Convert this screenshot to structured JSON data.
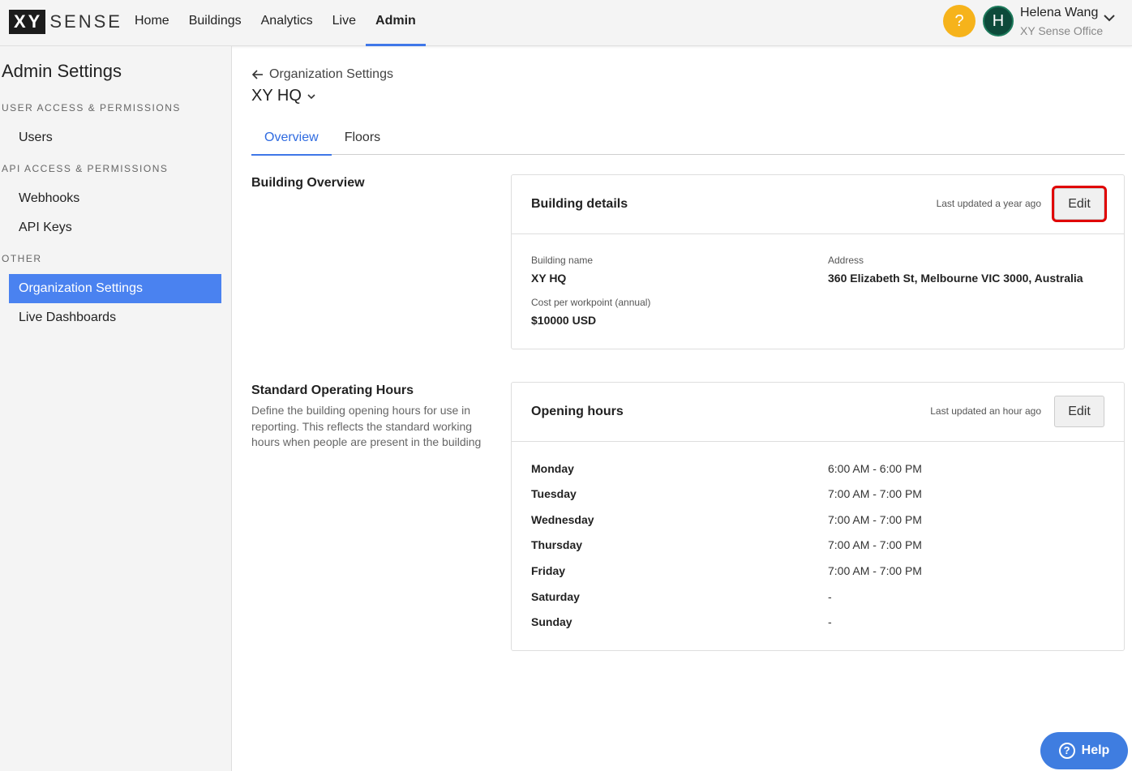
{
  "app": {
    "logo_box": "XY",
    "logo_text": "SENSE"
  },
  "nav": {
    "items": [
      {
        "label": "Home"
      },
      {
        "label": "Buildings"
      },
      {
        "label": "Analytics"
      },
      {
        "label": "Live"
      },
      {
        "label": "Admin"
      }
    ],
    "active": "Admin"
  },
  "user": {
    "help_glyph": "?",
    "avatar_initial": "H",
    "name": "Helena Wang",
    "org": "XY Sense Office"
  },
  "sidebar": {
    "title": "Admin Settings",
    "sections": [
      {
        "heading": "USER ACCESS & PERMISSIONS",
        "items": [
          "Users"
        ]
      },
      {
        "heading": "API ACCESS & PERMISSIONS",
        "items": [
          "Webhooks",
          "API Keys"
        ]
      },
      {
        "heading": "OTHER",
        "items": [
          "Organization Settings",
          "Live Dashboards"
        ]
      }
    ],
    "active_item": "Organization Settings"
  },
  "page": {
    "back_label": "Organization Settings",
    "building_title": "XY HQ",
    "tabs": [
      "Overview",
      "Floors"
    ],
    "active_tab": "Overview"
  },
  "building_overview": {
    "section_title": "Building Overview",
    "card_title": "Building details",
    "last_updated": "Last updated a year ago",
    "edit_label": "Edit",
    "fields": {
      "building_name_label": "Building name",
      "building_name_value": "XY HQ",
      "cost_label": "Cost per workpoint (annual)",
      "cost_value": "$10000 USD",
      "address_label": "Address",
      "address_value": "360 Elizabeth St, Melbourne VIC 3000, Australia"
    }
  },
  "operating_hours": {
    "section_title": "Standard Operating Hours",
    "description": "Define the building opening hours for use in reporting. This reflects the standard working hours when people are present in the building",
    "card_title": "Opening hours",
    "last_updated": "Last updated an hour ago",
    "edit_label": "Edit",
    "days": [
      {
        "day": "Monday",
        "hours": "6:00 AM - 6:00 PM"
      },
      {
        "day": "Tuesday",
        "hours": "7:00 AM - 7:00 PM"
      },
      {
        "day": "Wednesday",
        "hours": "7:00 AM - 7:00 PM"
      },
      {
        "day": "Thursday",
        "hours": "7:00 AM - 7:00 PM"
      },
      {
        "day": "Friday",
        "hours": "7:00 AM - 7:00 PM"
      },
      {
        "day": "Saturday",
        "hours": "-"
      },
      {
        "day": "Sunday",
        "hours": "-"
      }
    ]
  },
  "help_fab": {
    "glyph": "?",
    "label": "Help"
  },
  "colors": {
    "accent": "#3f77e8",
    "sidebar_active": "#4a82f0",
    "help_yellow": "#f6b31b",
    "avatar_green": "#0d4a3a",
    "highlight_red": "#e00000"
  }
}
